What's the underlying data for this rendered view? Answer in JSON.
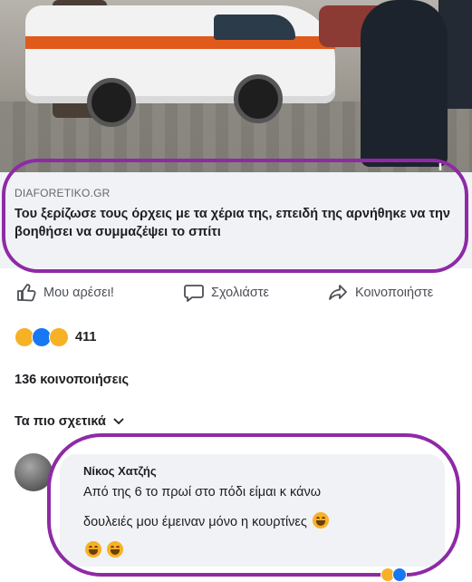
{
  "link_preview": {
    "domain": "DIAFORETIKO.GR",
    "headline": "Του ξερίζωσε τους όρχεις με τα χέρια της, επειδή της αρνήθηκε να την βοηθήσει να συμμαζέψει το σπίτι",
    "info_glyph": "i"
  },
  "actions": {
    "like_label": "Μου αρέσει!",
    "comment_label": "Σχολιάστε",
    "share_label": "Κοινοποιήστε"
  },
  "reactions": {
    "types": [
      "haha-icon",
      "like-icon",
      "wow-icon"
    ],
    "count": "411"
  },
  "shares_label": "136 κοινοποιήσεις",
  "sort": {
    "label": "Τα πιο σχετικά"
  },
  "comment": {
    "author": "Νίκος Χατζής",
    "line1": "Από της 6 το πρωί στο πόδι είμαι κ κάνω",
    "line2": "δουλειές μου έμειναν μόνο η κουρτίνες"
  },
  "colors": {
    "highlight": "#8e2aa6",
    "facebook_blue": "#1877f2",
    "reaction_yellow": "#f7b125"
  }
}
